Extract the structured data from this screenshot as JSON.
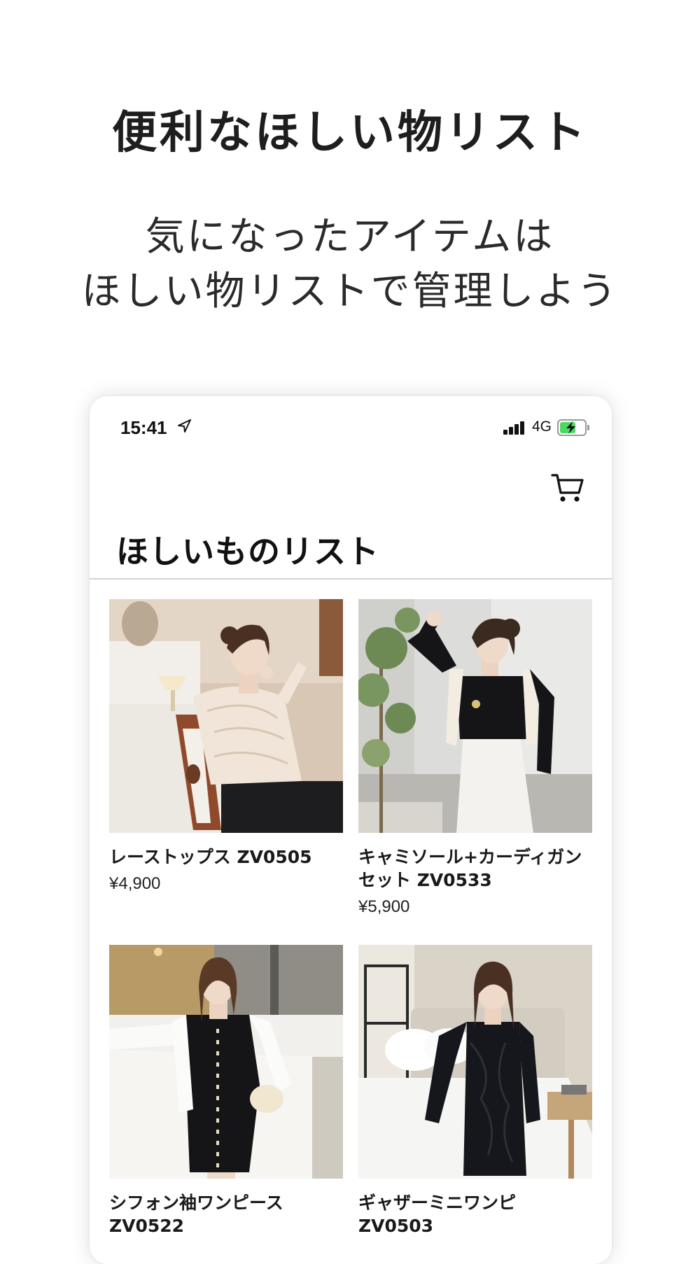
{
  "promo": {
    "title": "便利なほしい物リスト",
    "subtitle_line1": "気になったアイテムは",
    "subtitle_line2": "ほしい物リストで管理しよう"
  },
  "status_bar": {
    "time": "15:41",
    "network": "4G",
    "icons": [
      "location-arrow-icon",
      "signal-icon",
      "battery-charging-icon"
    ]
  },
  "header": {
    "cart_icon": "cart-icon",
    "title": "ほしいものリスト"
  },
  "products": [
    {
      "name": "レーストップス ZV0505",
      "price": "¥4,900"
    },
    {
      "name": "キャミソール+カーディガン\nセット ZV0533",
      "price": "¥5,900"
    },
    {
      "name": "シフォン袖ワンピース\nZV0522",
      "price": ""
    },
    {
      "name": "ギャザーミニワンピ\nZV0503",
      "price": ""
    }
  ],
  "colors": {
    "text": "#222222",
    "divider": "#d4d4d4",
    "battery_charge": "#4cd964"
  }
}
